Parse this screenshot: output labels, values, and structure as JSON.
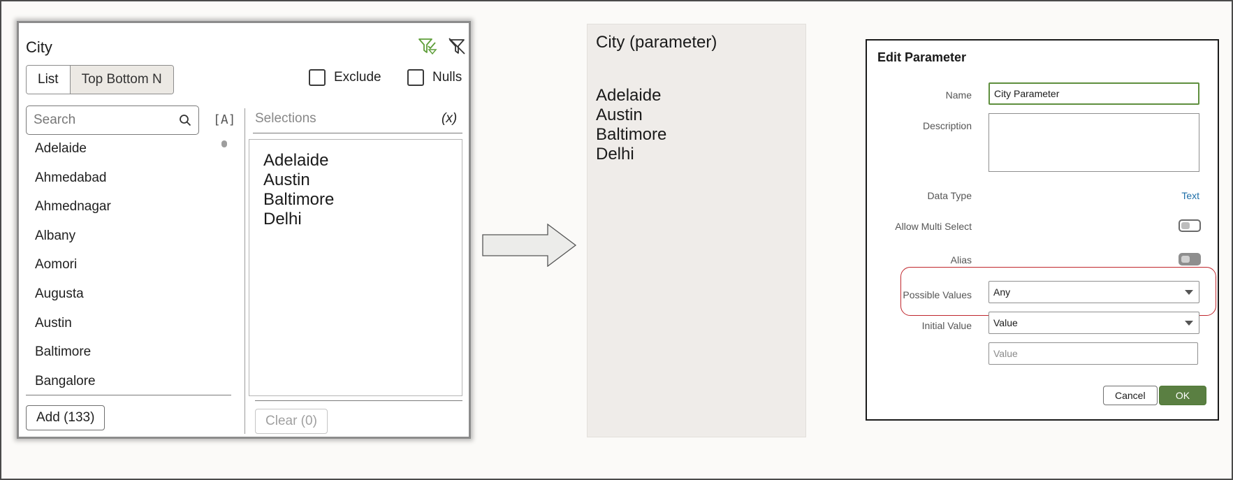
{
  "filter_panel": {
    "title": "City",
    "segment": {
      "list_label": "List",
      "top_bottom_label": "Top Bottom N"
    },
    "exclude_label": "Exclude",
    "nulls_label": "Nulls",
    "search_placeholder": "Search",
    "sort_glyph": "[A]",
    "cities": [
      "Adelaide",
      "Ahmedabad",
      "Ahmednagar",
      "Albany",
      "Aomori",
      "Augusta",
      "Austin",
      "Baltimore",
      "Bangalore"
    ],
    "add_label": "Add (133)",
    "selections_title": "Selections",
    "variable_glyph": "(x)",
    "selections": [
      "Adelaide",
      "Austin",
      "Baltimore",
      "Delhi"
    ],
    "clear_label": "Clear (0)",
    "icons": {
      "filter_active": "filter-check-icon",
      "filter_clear": "filter-off-icon",
      "search": "search-icon"
    },
    "accent_color": "#5f9e3a"
  },
  "param_panel": {
    "title": "City (parameter)",
    "values": [
      "Adelaide",
      "Austin",
      "Baltimore",
      "Delhi"
    ]
  },
  "edit_dialog": {
    "title": "Edit Parameter",
    "name_label": "Name",
    "name_value": "City Parameter",
    "description_label": "Description",
    "data_type_label": "Data Type",
    "data_type_value": "Text",
    "multi_select_label": "Allow Multi Select",
    "alias_label": "Alias",
    "possible_values_label": "Possible Values",
    "possible_values_value": "Any",
    "initial_value_label": "Initial Value",
    "initial_value_value": "Value",
    "value_placeholder": "Value",
    "cancel_label": "Cancel",
    "ok_label": "OK",
    "highlight_color": "#c0272d",
    "ok_color": "#5a7f42",
    "link_color": "#1f6fa8"
  }
}
